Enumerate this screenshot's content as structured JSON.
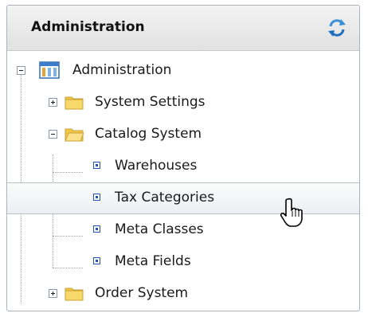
{
  "panel": {
    "title": "Administration",
    "refresh_icon": "refresh-icon"
  },
  "tree": {
    "root": {
      "label": "Administration",
      "icon": "administration-icon",
      "expanded": true
    },
    "items": [
      {
        "label": "System Settings",
        "icon": "folder-icon",
        "expanded": false
      },
      {
        "label": "Catalog System",
        "icon": "folder-open-icon",
        "expanded": true,
        "children": [
          {
            "label": "Warehouses"
          },
          {
            "label": "Tax Categories",
            "hovered": true
          },
          {
            "label": "Meta Classes"
          },
          {
            "label": "Meta Fields"
          }
        ]
      },
      {
        "label": "Order System",
        "icon": "folder-icon",
        "expanded": false
      }
    ]
  },
  "colors": {
    "link_blue": "#2255b0",
    "folder": "#f2c84b",
    "refresh": "#3a8fd6"
  }
}
